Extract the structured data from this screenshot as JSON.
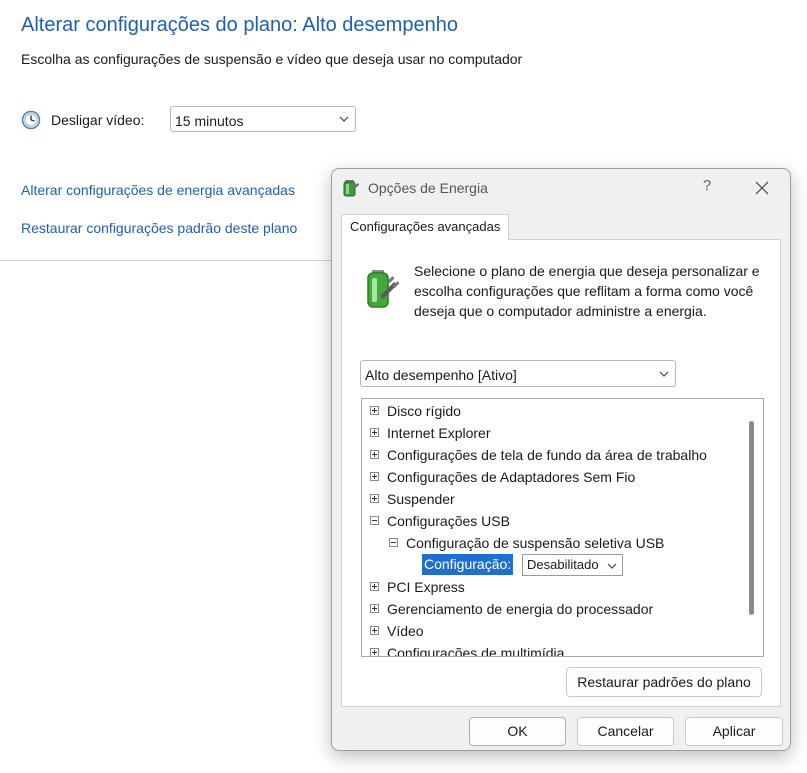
{
  "panel": {
    "title": "Alterar configurações do plano: Alto desempenho",
    "subtitle": "Escolha as configurações de suspensão e vídeo que deseja usar no computador",
    "display_off_label": "Desligar vídeo:",
    "display_off_value": "15 minutos",
    "advanced_link": "Alterar configurações de energia avançadas",
    "restore_link": "Restaurar configurações padrão deste plano",
    "accent_color": "#1f5fb2"
  },
  "dialog": {
    "title": "Opções de Energia",
    "help": "?",
    "tab": "Configurações avançadas",
    "intro": "Selecione o plano de energia que deseja personalizar e escolha configurações que reflitam a forma como você deseja que o computador administre a energia.",
    "plan": "Alto desempenho [Ativo]",
    "tree": [
      {
        "label": "Disco rígido",
        "expander": "plus"
      },
      {
        "label": "Internet Explorer",
        "expander": "plus"
      },
      {
        "label": "Configurações de tela de fundo da área de trabalho",
        "expander": "plus"
      },
      {
        "label": "Configurações de Adaptadores Sem Fio",
        "expander": "plus"
      },
      {
        "label": "Suspender",
        "expander": "plus"
      },
      {
        "label": "Configurações USB",
        "expander": "minus"
      },
      {
        "label": "Configuração de suspensão seletiva USB",
        "expander": "minus"
      },
      {
        "label": "Configuração:",
        "value": "Desabilitado"
      },
      {
        "label": "PCI Express",
        "expander": "plus"
      },
      {
        "label": "Gerenciamento de energia do processador",
        "expander": "plus"
      },
      {
        "label": "Vídeo",
        "expander": "plus"
      },
      {
        "label": "Configurações de multimídia",
        "expander": "plus"
      }
    ],
    "restore_button": "Restaurar padrões do plano",
    "ok": "OK",
    "cancel": "Cancelar",
    "apply": "Aplicar",
    "selection_color": "#1f6fd1"
  }
}
